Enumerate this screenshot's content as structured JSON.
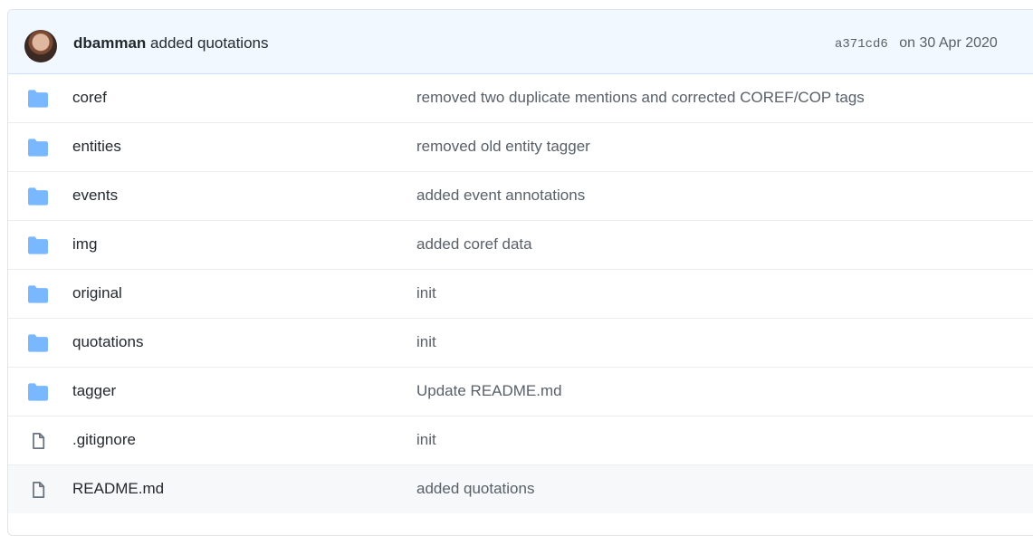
{
  "commit": {
    "author": "dbamman",
    "message": "added quotations",
    "sha": "a371cd6",
    "date": "on 30 Apr 2020"
  },
  "files": [
    {
      "name": "coref",
      "type": "folder",
      "message": "removed two duplicate mentions and corrected COREF/COP tags"
    },
    {
      "name": "entities",
      "type": "folder",
      "message": "removed old entity tagger"
    },
    {
      "name": "events",
      "type": "folder",
      "message": "added event annotations"
    },
    {
      "name": "img",
      "type": "folder",
      "message": "added coref data"
    },
    {
      "name": "original",
      "type": "folder",
      "message": "init"
    },
    {
      "name": "quotations",
      "type": "folder",
      "message": "init"
    },
    {
      "name": "tagger",
      "type": "folder",
      "message": "Update README.md"
    },
    {
      "name": ".gitignore",
      "type": "file",
      "message": "init"
    },
    {
      "name": "README.md",
      "type": "file",
      "message": "added quotations"
    }
  ],
  "colors": {
    "folder_icon": "#79b8ff",
    "file_icon": "#6a737d",
    "commit_bar_bg": "#f1f8ff",
    "highlight_row_bg": "#f6f8fa"
  }
}
